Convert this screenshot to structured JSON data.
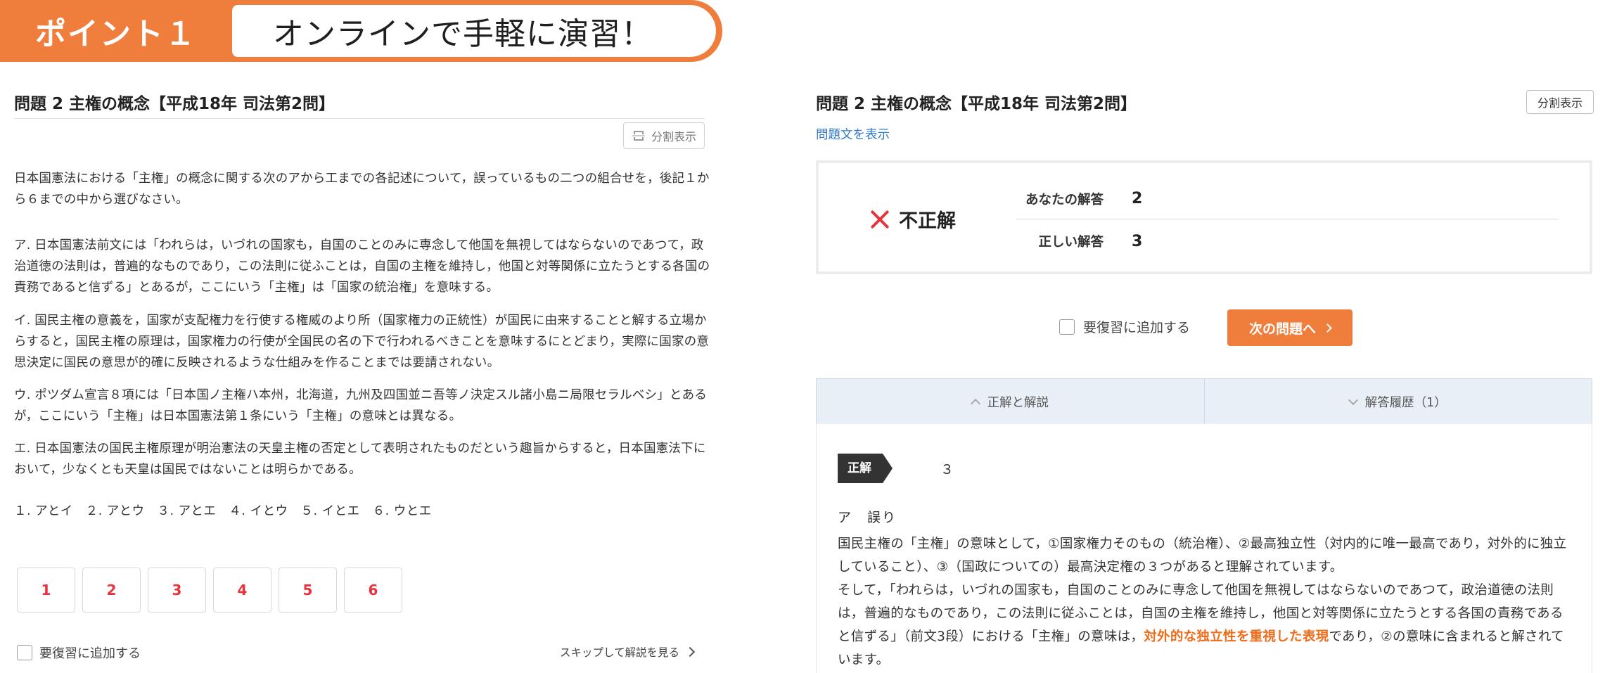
{
  "banner": {
    "label": "ポイント１",
    "headline": "オンラインで手軽に演習！"
  },
  "colors": {
    "accent_orange": "#ef7d3c",
    "answer_number_red": "#e8323c",
    "link_blue": "#2f7ad0",
    "highlight_orange": "#ef6c1a",
    "tab_background": "#e9eff7"
  },
  "question_panel": {
    "title": "問題 2 主権の概念【平成18年 司法第2問】",
    "split_view_label": "分割表示",
    "instruction": "日本国憲法における「主権」の概念に関する次のアから工までの各記述について，誤っているもの二つの組合せを，後記１から６までの中から選びなさい。",
    "statements": [
      "ア. 日本国憲法前文には「われらは，いづれの国家も，自国のことのみに専念して他国を無視してはならないのであつて，政治道徳の法則は，普遍的なものであり，この法則に従ふことは，自国の主権を維持し，他国と対等関係に立たうとする各国の責務であると信ずる」とあるが，ここにいう「主権」は「国家の統治権」を意味する。",
      "イ. 国民主権の意義を，国家が支配権力を行使する権威のより所（国家権力の正統性）が国民に由来することと解する立場からすると，国民主権の原理は，国家権力の行使が全国民の名の下で行われるべきことを意味するにとどまり，実際に国家の意思決定に国民の意思が的確に反映されるような仕組みを作ることまでは要請されない。",
      "ウ. ポツダム宣言８項には「日本国ノ主権ハ本州，北海道，九州及四国並ニ吾等ノ決定スル諸小島ニ局限セラルベシ」とあるが，ここにいう「主権」は日本国憲法第１条にいう「主権」の意味とは異なる。",
      "エ. 日本国憲法の国民主権原理が明治憲法の天皇主権の否定として表明されたものだという趣旨からすると，日本国憲法下において，少なくとも天皇は国民ではないことは明らかである。"
    ],
    "choices_line": "１. アとイ　２. アとウ　３. アとエ　４. イとウ　５. イとエ　６. ウとエ",
    "answer_buttons": [
      "1",
      "2",
      "3",
      "4",
      "5",
      "6"
    ],
    "review_label": "要復習に追加する",
    "skip_label": "スキップして解説を見る"
  },
  "answer_panel": {
    "title": "問題 2 主権の概念【平成18年 司法第2問】",
    "split_view_label": "分割表示",
    "show_question_link": "問題文を表示",
    "result": {
      "status": "不正解",
      "your_answer_label": "あなたの解答",
      "your_answer_value": "2",
      "correct_answer_label": "正しい解答",
      "correct_answer_value": "3"
    },
    "review_label": "要復習に追加する",
    "next_button": "次の問題へ",
    "tabs": [
      {
        "label": "正解と解説",
        "icon": "chevron-up-icon",
        "active": true
      },
      {
        "label": "解答履歴（1）",
        "icon": "chevron-down-icon",
        "active": false
      }
    ],
    "explanation": {
      "correct_tag": "正解",
      "correct_value": "３",
      "heading": "ア　誤り",
      "paragraph1": "国民主権の「主権」の意味として，①国家権力そのもの（統治権）、②最高独立性（対内的に唯一最高であり，対外的に独立していること）、③（国政についての）最高決定権の３つがあると理解されています。",
      "paragraph2_before": "そして，「われらは，いづれの国家も，自国のことのみに専念して他国を無視してはならないのであつて，政治道徳の法則は，普遍的なものであり，この法則に従ふことは，自国の主権を維持し，他国と対等関係に立たうとする各国の責務であると信ずる」（前文3段）における「主権」の意味は，",
      "paragraph2_highlight": "対外的な独立性を重視した表現",
      "paragraph2_after": "であり，②の意味に含まれると解されています。"
    }
  }
}
